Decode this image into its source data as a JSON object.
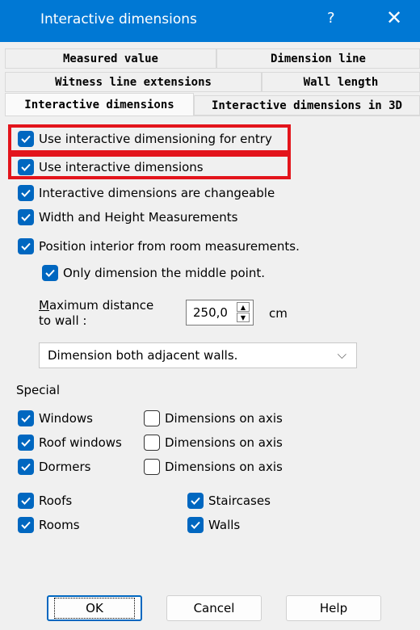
{
  "window": {
    "title": "Interactive dimensions",
    "help_glyph": "?",
    "close_glyph": "✕"
  },
  "tabs": [
    "Measured value",
    "Dimension line",
    "Witness line extensions",
    "Wall length",
    "Interactive dimensions",
    "Interactive dimensions in 3D"
  ],
  "options": {
    "use_for_entry": "Use interactive dimensioning for entry",
    "use_interactive": "Use interactive dimensions",
    "changeable": "Interactive dimensions are changeable",
    "width_height": "Width and Height Measurements",
    "position_interior": "Position interior from room measurements.",
    "middle_point": "Only dimension the middle point."
  },
  "max_distance": {
    "label_line1_underlined": "M",
    "label_line1_rest": "aximum distance",
    "label_line2": "to wall :",
    "value": "250,0",
    "unit": "cm"
  },
  "adjacent_select": {
    "selected": "Dimension both adjacent walls."
  },
  "special": {
    "label": "Special",
    "rows": [
      {
        "item": "Windows",
        "axis": "Dimensions on axis"
      },
      {
        "item": "Roof windows",
        "axis": "Dimensions on axis"
      },
      {
        "item": "Dormers",
        "axis": "Dimensions on axis"
      }
    ]
  },
  "other": {
    "roofs": "Roofs",
    "staircases": "Staircases",
    "rooms": "Rooms",
    "walls": "Walls"
  },
  "buttons": {
    "ok": "OK",
    "cancel": "Cancel",
    "help": "Help"
  },
  "colors": {
    "titlebar": "#0078d4",
    "accent": "#0067c0",
    "highlight": "#e3141b"
  }
}
